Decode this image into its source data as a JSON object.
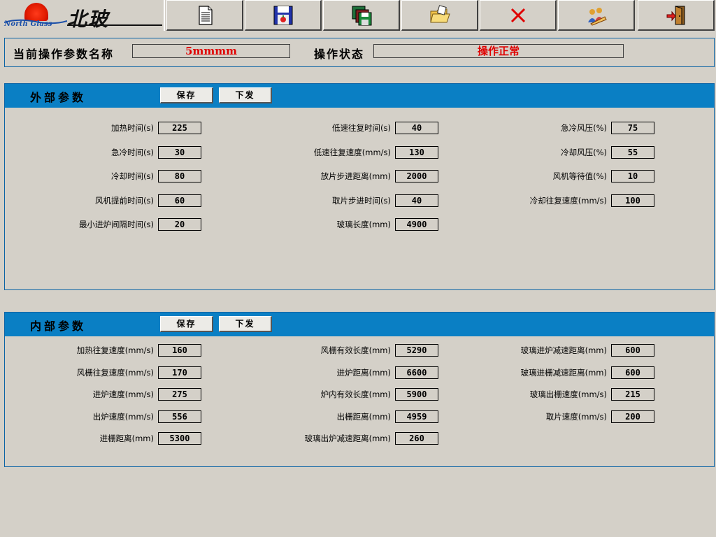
{
  "colors": {
    "accent": "#0a7fc4",
    "status_text": "#e00000",
    "background": "#d4d0c8"
  },
  "logo": {
    "brand_en": "North Glass",
    "brand_cn": "北玻"
  },
  "toolbar": {
    "buttons": [
      {
        "icon": "document-icon"
      },
      {
        "icon": "save-disk-icon"
      },
      {
        "icon": "multi-save-icon"
      },
      {
        "icon": "open-folder-icon"
      },
      {
        "icon": "delete-x-icon"
      },
      {
        "icon": "users-icon"
      },
      {
        "icon": "exit-door-icon"
      }
    ]
  },
  "status": {
    "param_name_label": "当前操作参数名称",
    "param_name_value": "5mmmm",
    "op_state_label": "操作状态",
    "op_state_value": "操作正常"
  },
  "external": {
    "title": "外部参数",
    "save_label": "保存",
    "send_label": "下发",
    "col1": [
      {
        "label": "加热时间(s)",
        "value": "225"
      },
      {
        "label": "急冷时间(s)",
        "value": "30"
      },
      {
        "label": "冷却时间(s)",
        "value": "80"
      },
      {
        "label": "风机提前时间(s)",
        "value": "60"
      },
      {
        "label": "最小进炉间隔时间(s)",
        "value": "20"
      }
    ],
    "col2": [
      {
        "label": "低速往复时间(s)",
        "value": "40"
      },
      {
        "label": "低速往复速度(mm/s)",
        "value": "130"
      },
      {
        "label": "放片步进距离(mm)",
        "value": "2000"
      },
      {
        "label": "取片步进时间(s)",
        "value": "40"
      },
      {
        "label": "玻璃长度(mm)",
        "value": "4900"
      }
    ],
    "col3": [
      {
        "label": "急冷风压(%)",
        "value": "75"
      },
      {
        "label": "冷却风压(%)",
        "value": "55"
      },
      {
        "label": "风机等待值(%)",
        "value": "10"
      },
      {
        "label": "冷却往复速度(mm/s)",
        "value": "100"
      }
    ]
  },
  "internal": {
    "title": "内部参数",
    "save_label": "保存",
    "send_label": "下发",
    "col1": [
      {
        "label": "加热往复速度(mm/s)",
        "value": "160"
      },
      {
        "label": "风栅往复速度(mm/s)",
        "value": "170"
      },
      {
        "label": "进炉速度(mm/s)",
        "value": "275"
      },
      {
        "label": "出炉速度(mm/s)",
        "value": "556"
      },
      {
        "label": "进栅距离(mm)",
        "value": "5300"
      }
    ],
    "col2": [
      {
        "label": "风栅有效长度(mm)",
        "value": "5290"
      },
      {
        "label": "进炉距离(mm)",
        "value": "6600"
      },
      {
        "label": "炉内有效长度(mm)",
        "value": "5900"
      },
      {
        "label": "出栅距离(mm)",
        "value": "4959"
      },
      {
        "label": "玻璃出炉减速距离(mm)",
        "value": "260"
      }
    ],
    "col3": [
      {
        "label": "玻璃进炉减速距离(mm)",
        "value": "600"
      },
      {
        "label": "玻璃进栅减速距离(mm)",
        "value": "600"
      },
      {
        "label": "玻璃出栅速度(mm/s)",
        "value": "215"
      },
      {
        "label": "取片速度(mm/s)",
        "value": "200"
      }
    ]
  }
}
